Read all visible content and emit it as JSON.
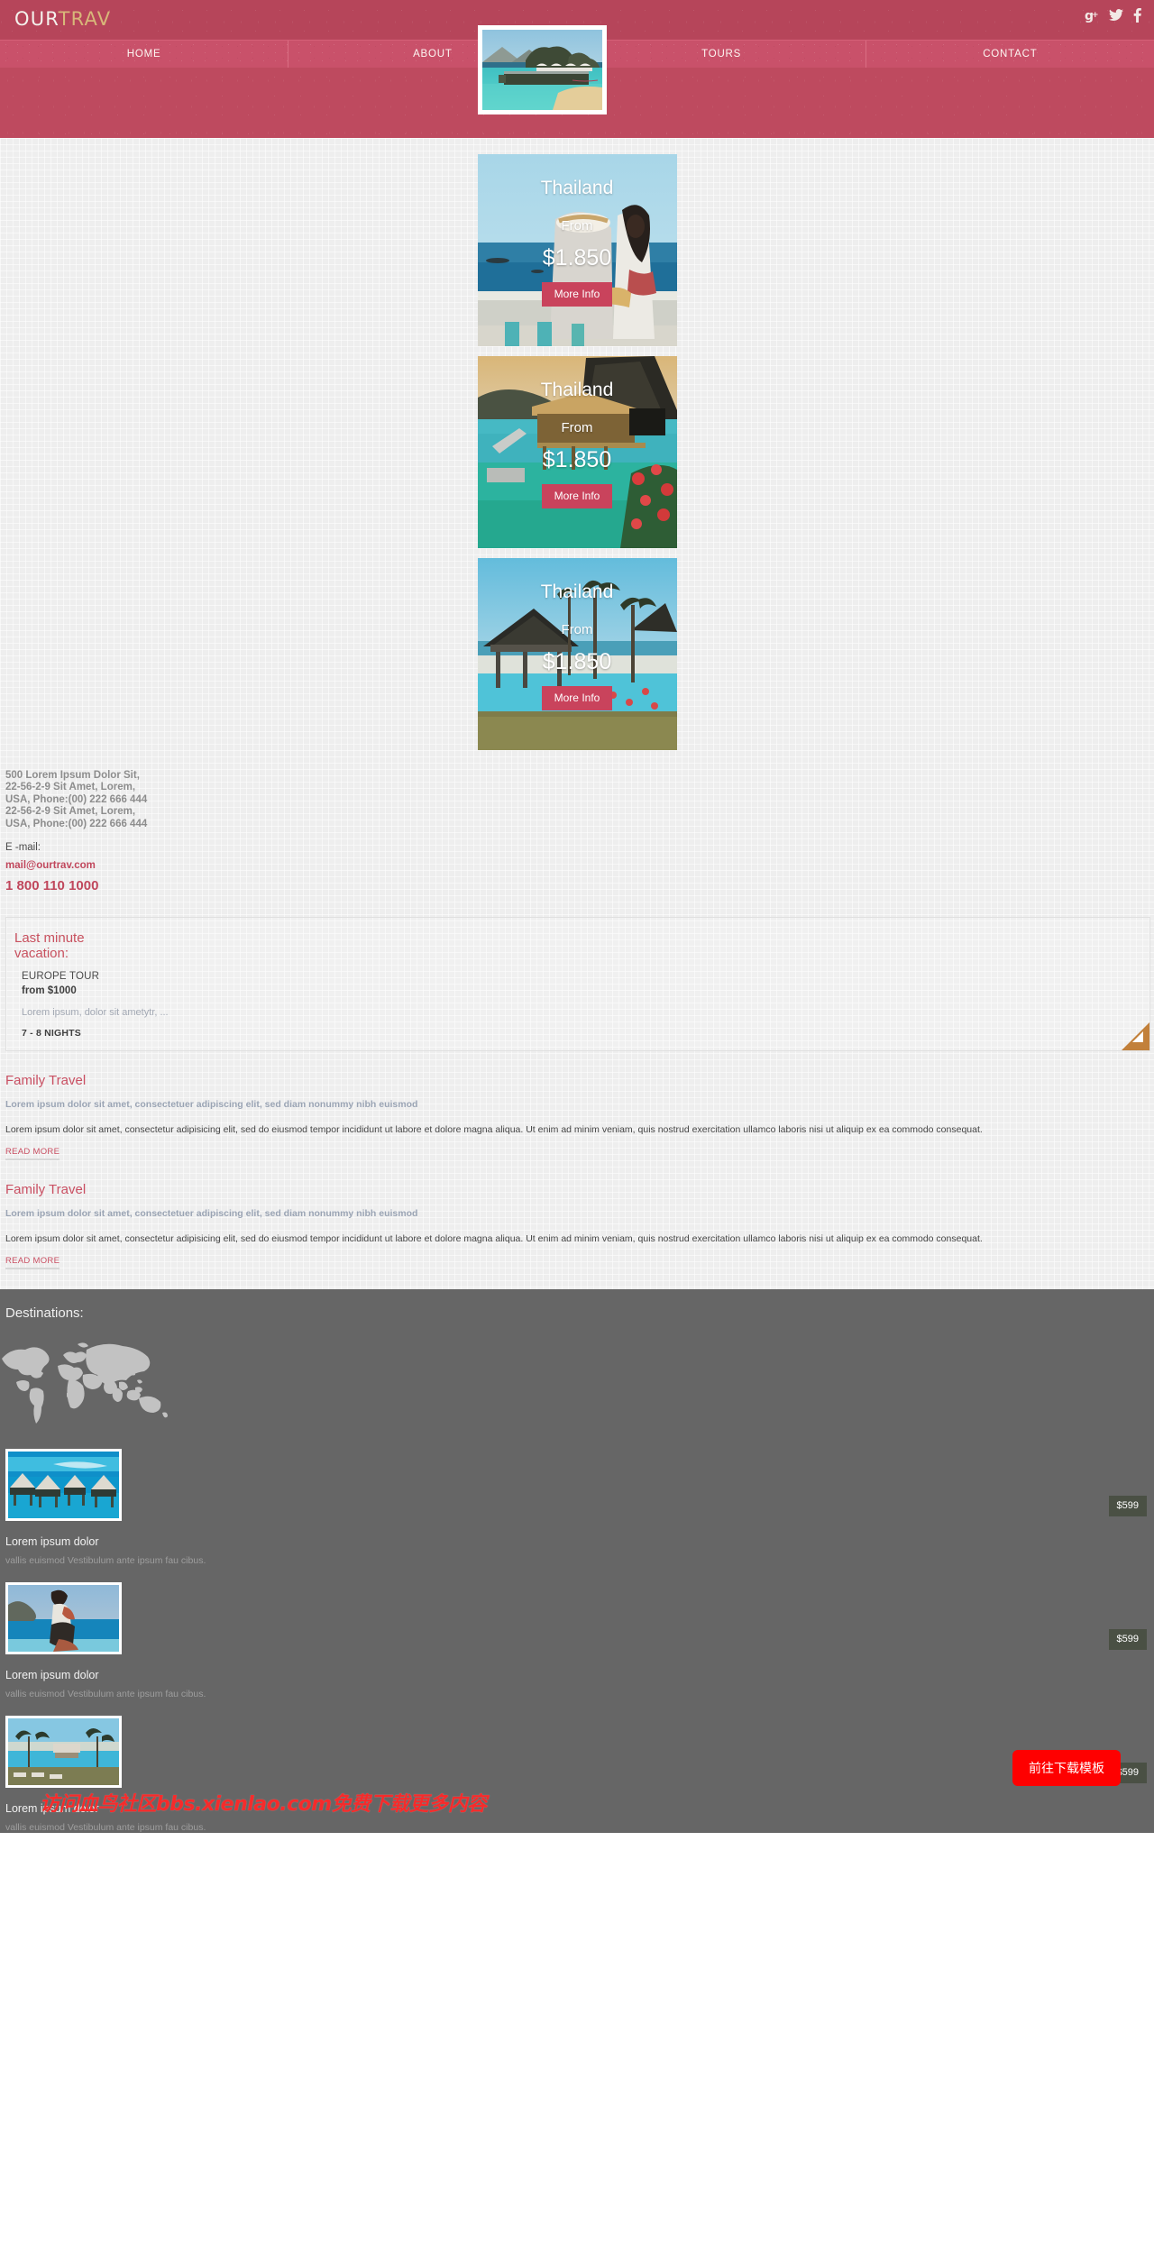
{
  "brand": {
    "logo_primary": "OUR",
    "logo_secondary": "TRAV"
  },
  "colors": {
    "topbar": "#b6455a",
    "nav": "#c9516a",
    "accent_red": "#c94f62",
    "button_red": "#c9435c",
    "gold": "#d8b779",
    "dark_section": "#666666",
    "price_badge": "#4a5044",
    "ribbon_orange": "#c2803a",
    "download_red": "#fe0000",
    "watermark_red": "#f62b2b"
  },
  "socials": [
    {
      "name": "google-plus-icon",
      "glyph": "g+"
    },
    {
      "name": "twitter-icon",
      "glyph": "t"
    },
    {
      "name": "facebook-icon",
      "glyph": "f"
    }
  ],
  "nav": {
    "items": [
      {
        "label": "HOME"
      },
      {
        "label": "ABOUT"
      },
      {
        "label": "TOURS"
      },
      {
        "label": "CONTACT"
      }
    ]
  },
  "hero": {
    "image_alt": "tropical-resort-bungalow-over-water"
  },
  "cards": [
    {
      "title": "Thailand",
      "from_label": "From",
      "price": "$1.850",
      "button": "More Info",
      "image_alt": "couple-sitting-on-seaside-wall"
    },
    {
      "title": "Thailand",
      "from_label": "From",
      "price": "$1.850",
      "button": "More Info",
      "image_alt": "overwater-bungalow-with-red-flowers"
    },
    {
      "title": "Thailand",
      "from_label": "From",
      "price": "$1.850",
      "button": "More Info",
      "image_alt": "thai-pavilion-by-pool-with-palms"
    }
  ],
  "contact": {
    "address_lines": [
      "500 Lorem Ipsum Dolor Sit,",
      "22-56-2-9  Sit Amet, Lorem,",
      "USA, Phone:(00) 222 666 444",
      "22-56-2-9  Sit Amet, Lorem,",
      "USA, Phone:(00) 222 666 444"
    ],
    "email_label": "E -mail:",
    "email": "mail@ourtrav.com",
    "phone": "1 800 110 1000"
  },
  "last_minute": {
    "title": "Last minute vacation:",
    "tour": "EUROPE TOUR",
    "price": "from $1000",
    "description": "Lorem ipsum, dolor sit ametytr, ...",
    "nights": "7 - 8 NIGHTS"
  },
  "articles": [
    {
      "title": "Family Travel",
      "subtitle": "Lorem ipsum dolor sit amet, consectetuer adipiscing elit, sed diam nonummy nibh euismod",
      "body": "Lorem ipsum dolor sit amet, consectetur adipisicing elit, sed do eiusmod tempor incididunt ut labore et dolore magna aliqua. Ut enim ad minim veniam, quis nostrud exercitation ullamco laboris nisi ut aliquip ex ea commodo consequat.",
      "read_more": "READ MORE"
    },
    {
      "title": "Family Travel",
      "subtitle": "Lorem ipsum dolor sit amet, consectetuer adipiscing elit, sed diam nonummy nibh euismod",
      "body": "Lorem ipsum dolor sit amet, consectetur adipisicing elit, sed do eiusmod tempor incididunt ut labore et dolore magna aliqua. Ut enim ad minim veniam, quis nostrud exercitation ullamco laboris nisi ut aliquip ex ea commodo consequat.",
      "read_more": "READ MORE"
    }
  ],
  "destinations": {
    "title": "Destinations:",
    "items": [
      {
        "name": "Lorem ipsum dolor",
        "description": "vallis euismod Vestibulum ante ipsum fau cibus.",
        "price": "$599",
        "image_alt": "overwater-huts-turquoise-lagoon"
      },
      {
        "name": "Lorem ipsum dolor",
        "description": "vallis euismod Vestibulum ante ipsum fau cibus.",
        "price": "$599",
        "image_alt": "woman-on-beach-with-sea"
      },
      {
        "name": "Lorem ipsum dolor",
        "description": "vallis euismod Vestibulum ante ipsum fau cibus.",
        "price": "$599",
        "image_alt": "resort-pool-with-palm-trees"
      }
    ]
  },
  "overlay": {
    "download_button": "前往下载模板",
    "watermark": "访问血鸟社区bbs.xienlao.com免费下载更多内容"
  }
}
